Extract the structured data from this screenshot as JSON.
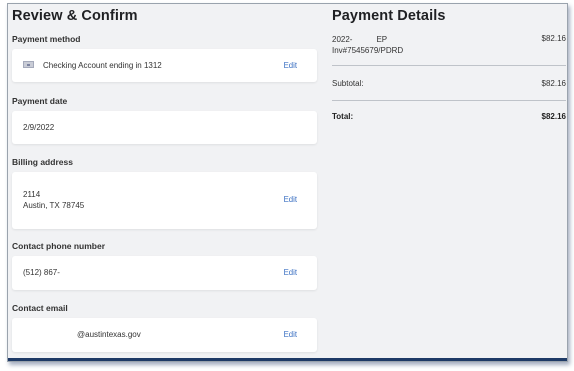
{
  "review": {
    "title": "Review & Confirm",
    "payment_method": {
      "label": "Payment method",
      "value": "Checking Account ending in 1312",
      "icon": "bank-card-icon",
      "edit": "Edit"
    },
    "payment_date": {
      "label": "Payment date",
      "value": "2/9/2022"
    },
    "billing_address": {
      "label": "Billing address",
      "line1": "2114",
      "line2": "Austin, TX 78745",
      "edit": "Edit"
    },
    "contact_phone": {
      "label": "Contact phone number",
      "value": "(512) 867-",
      "edit": "Edit"
    },
    "contact_email": {
      "label": "Contact email",
      "value": "@austintexas.gov",
      "edit": "Edit"
    }
  },
  "payment_details": {
    "title": "Payment Details",
    "item": {
      "name_part1": "2022-",
      "name_part2": "EP",
      "invoice": "Inv#7545679/PDRD",
      "amount": "$82.16"
    },
    "subtotal_label": "Subtotal:",
    "subtotal_value": "$82.16",
    "total_label": "Total:",
    "total_value": "$82.16"
  },
  "colors": {
    "background": "#f1f2f4",
    "card": "#ffffff",
    "link": "#3a6fc2",
    "frame_bottom": "#1e3a66"
  }
}
